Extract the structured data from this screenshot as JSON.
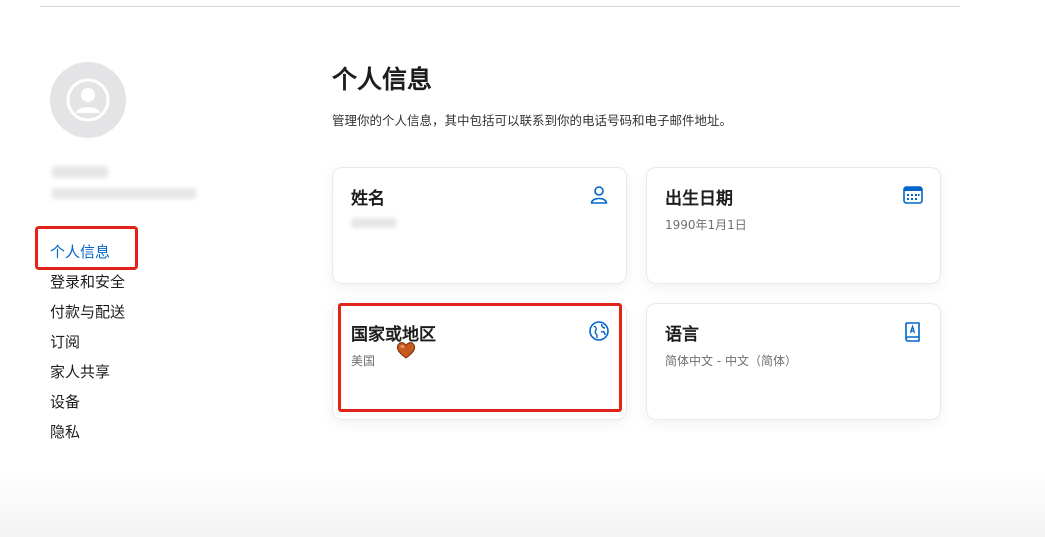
{
  "sidebar": {
    "items": [
      {
        "label": "个人信息",
        "active": true
      },
      {
        "label": "登录和安全"
      },
      {
        "label": "付款与配送"
      },
      {
        "label": "订阅"
      },
      {
        "label": "家人共享"
      },
      {
        "label": "设备"
      },
      {
        "label": "隐私"
      }
    ]
  },
  "main": {
    "title": "个人信息",
    "description": "管理你的个人信息，其中包括可以联系到你的电话号码和电子邮件地址。",
    "cards": [
      {
        "title": "姓名",
        "value": "",
        "icon": "person-icon"
      },
      {
        "title": "出生日期",
        "value": "1990年1月1日",
        "icon": "calendar-icon"
      },
      {
        "title": "国家或地区",
        "value": "美国",
        "icon": "globe-icon"
      },
      {
        "title": "语言",
        "value": "简体中文 - 中文（简体）",
        "icon": "book-icon"
      }
    ]
  },
  "colors": {
    "accent": "#0066cc",
    "highlight": "#e2231a"
  }
}
